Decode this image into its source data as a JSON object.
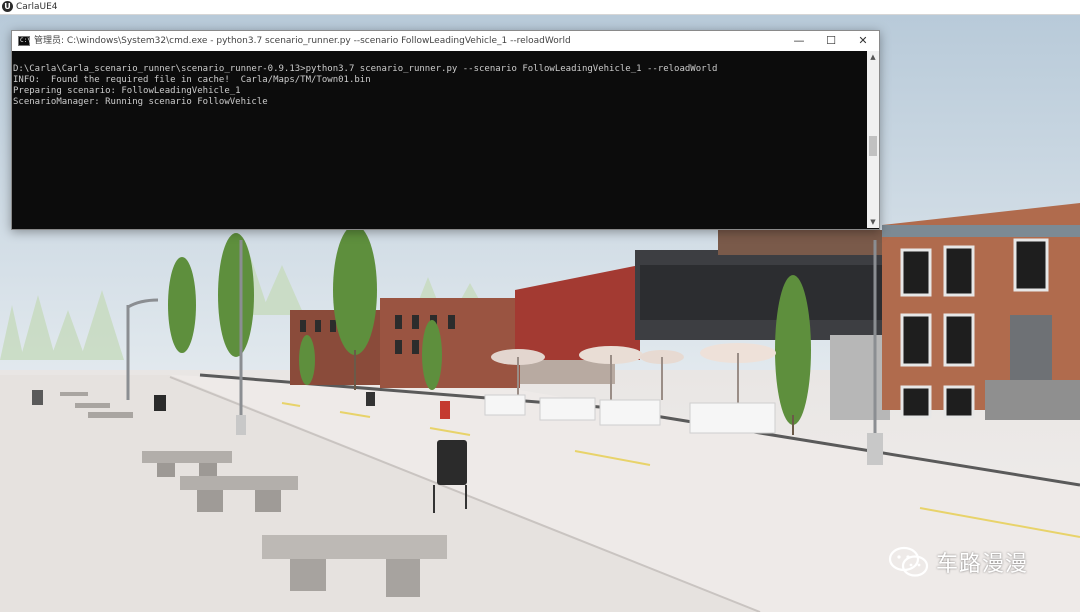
{
  "app": {
    "title": "CarlaUE4",
    "icon": "unreal-engine-icon"
  },
  "cmd_window": {
    "title": "管理员: C:\\windows\\System32\\cmd.exe - python3.7  scenario_runner.py --scenario FollowLeadingVehicle_1 --reloadWorld",
    "icon_text": "C:\\_",
    "controls": {
      "minimize": "—",
      "maximize": "☐",
      "close": "✕"
    },
    "lines": [
      "D:\\Carla\\Carla_scenario_runner\\scenario_runner-0.9.13>python3.7 scenario_runner.py --scenario FollowLeadingVehicle_1 --reloadWorld",
      "INFO:  Found the required file in cache!  Carla/Maps/TM/Town01.bin",
      "Preparing scenario: FollowLeadingVehicle_1",
      "ScenarioManager: Running scenario FollowVehicle"
    ]
  },
  "watermark": {
    "text": "车路漫漫",
    "icon": "wechat-icon"
  },
  "colors": {
    "console_bg": "#0c0c0c",
    "console_text": "#cccccc",
    "sky": "#cad7e3"
  }
}
